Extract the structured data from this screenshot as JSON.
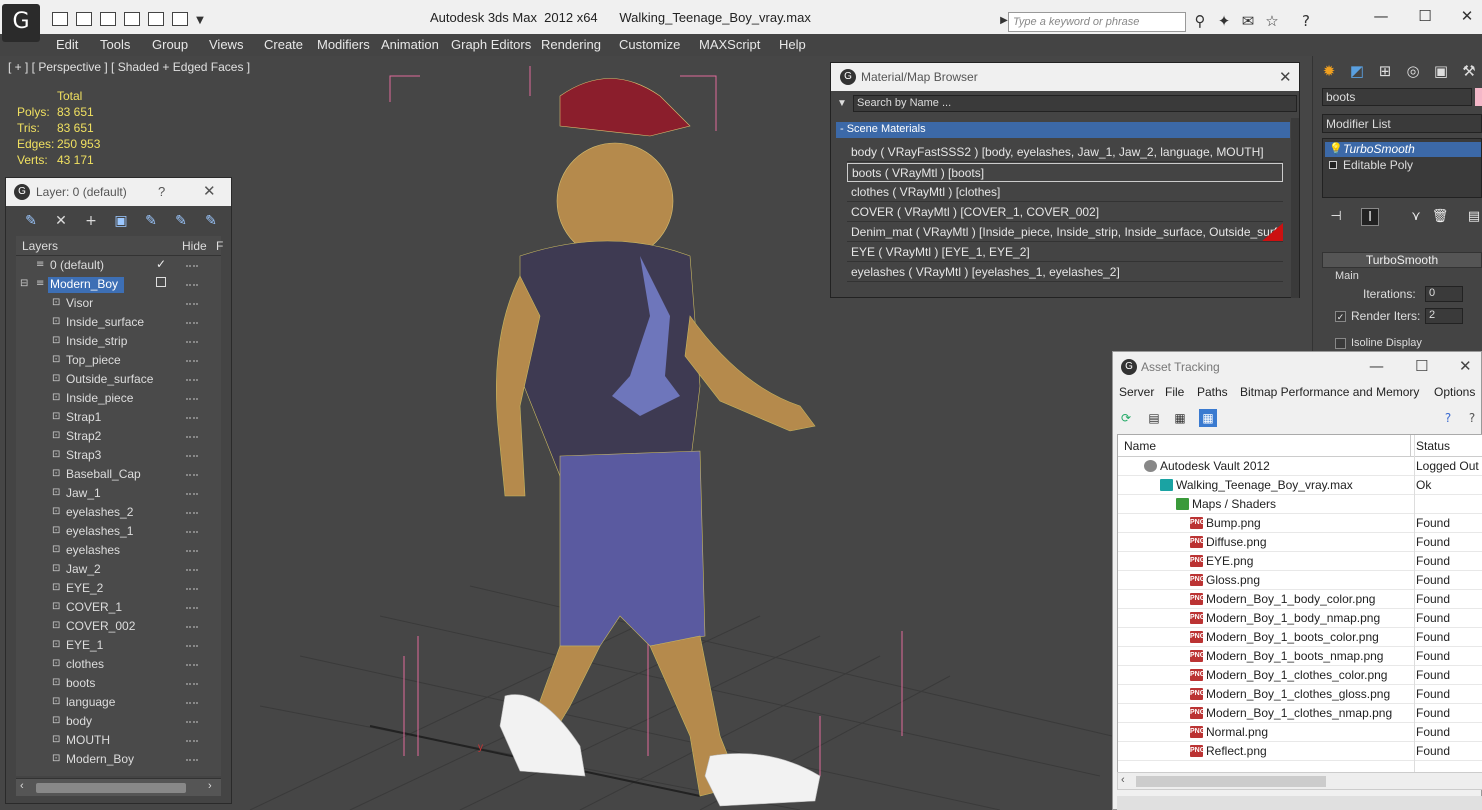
{
  "app": {
    "logo_glyph": "G",
    "title": "Autodesk 3ds Max  2012 x64      Walking_Teenage_Boy_vray.max",
    "search_placeholder": "Type a keyword or phrase"
  },
  "menu": [
    "Edit",
    "Tools",
    "Group",
    "Views",
    "Create",
    "Modifiers",
    "Animation",
    "Graph Editors",
    "Rendering",
    "Customize",
    "MAXScript",
    "Help"
  ],
  "viewport": {
    "label": "[ + ] [ Perspective ] [ Shaded + Edged Faces ]",
    "stats_header": "Total",
    "stats": [
      {
        "key": "Polys:",
        "value": "83 651"
      },
      {
        "key": "Tris:",
        "value": "83 651"
      },
      {
        "key": "Edges:",
        "value": "250 953"
      },
      {
        "key": "Verts:",
        "value": "43 171"
      }
    ],
    "axis_label": "y"
  },
  "layer_panel": {
    "title": "Layer: 0 (default)",
    "help": "?",
    "col_layers": "Layers",
    "col_hide": "Hide",
    "col_f": "F",
    "default_layer": "0 (default)",
    "selected_layer": "Modern_Boy",
    "objects": [
      "Visor",
      "Inside_surface",
      "Inside_strip",
      "Top_piece",
      "Outside_surface",
      "Inside_piece",
      "Strap1",
      "Strap2",
      "Strap3",
      "Baseball_Cap",
      "Jaw_1",
      "eyelashes_2",
      "eyelashes_1",
      "eyelashes",
      "Jaw_2",
      "EYE_2",
      "COVER_1",
      "COVER_002",
      "EYE_1",
      "clothes",
      "boots",
      "language",
      "body",
      "MOUTH",
      "Modern_Boy"
    ]
  },
  "material_browser": {
    "title": "Material/Map Browser",
    "search_placeholder": "Search by Name ...",
    "group_title": "- Scene Materials",
    "materials": [
      "body  ( VRayFastSSS2 ) [body, eyelashes, Jaw_1, Jaw_2, language, MOUTH]",
      "boots  ( VRayMtl ) [boots]",
      "clothes  ( VRayMtl ) [clothes]",
      "COVER  ( VRayMtl ) [COVER_1, COVER_002]",
      "Denim_mat  ( VRayMtl ) [Inside_piece, Inside_strip, Inside_surface, Outside_surfa...",
      "EYE  ( VRayMtl ) [EYE_1, EYE_2]",
      "eyelashes  ( VRayMtl ) [eyelashes_1, eyelashes_2]"
    ],
    "selected_index": 1
  },
  "command_panel": {
    "object_name": "boots",
    "object_color": "#f4b7c8",
    "modifier_list": "Modifier List",
    "stack": [
      "TurboSmooth",
      "Editable Poly"
    ],
    "rollout_title": "TurboSmooth",
    "main_label": "Main",
    "iterations_label": "Iterations:",
    "iterations_value": "0",
    "render_iters_label": "Render Iters:",
    "render_iters_value": "2",
    "render_iters_checked": true,
    "isoline_label": "Isoline Display"
  },
  "asset_tracking": {
    "title": "Asset Tracking",
    "menu": [
      "Server",
      "File",
      "Paths",
      "Bitmap Performance and Memory",
      "Options"
    ],
    "col_name": "Name",
    "col_status": "Status",
    "rows": [
      {
        "name": "Autodesk Vault 2012",
        "status": "Logged Out",
        "level": 0,
        "icon": "vault"
      },
      {
        "name": "Walking_Teenage_Boy_vray.max",
        "status": "Ok",
        "level": 1,
        "icon": "max"
      },
      {
        "name": "Maps / Shaders",
        "status": "",
        "level": 2,
        "icon": "folder"
      },
      {
        "name": "Bump.png",
        "status": "Found",
        "level": 3,
        "icon": "png"
      },
      {
        "name": "Diffuse.png",
        "status": "Found",
        "level": 3,
        "icon": "png"
      },
      {
        "name": "EYE.png",
        "status": "Found",
        "level": 3,
        "icon": "png"
      },
      {
        "name": "Gloss.png",
        "status": "Found",
        "level": 3,
        "icon": "png"
      },
      {
        "name": "Modern_Boy_1_body_color.png",
        "status": "Found",
        "level": 3,
        "icon": "png"
      },
      {
        "name": "Modern_Boy_1_body_nmap.png",
        "status": "Found",
        "level": 3,
        "icon": "png"
      },
      {
        "name": "Modern_Boy_1_boots_color.png",
        "status": "Found",
        "level": 3,
        "icon": "png"
      },
      {
        "name": "Modern_Boy_1_boots_nmap.png",
        "status": "Found",
        "level": 3,
        "icon": "png"
      },
      {
        "name": "Modern_Boy_1_clothes_color.png",
        "status": "Found",
        "level": 3,
        "icon": "png"
      },
      {
        "name": "Modern_Boy_1_clothes_gloss.png",
        "status": "Found",
        "level": 3,
        "icon": "png"
      },
      {
        "name": "Modern_Boy_1_clothes_nmap.png",
        "status": "Found",
        "level": 3,
        "icon": "png"
      },
      {
        "name": "Normal.png",
        "status": "Found",
        "level": 3,
        "icon": "png"
      },
      {
        "name": "Reflect.png",
        "status": "Found",
        "level": 3,
        "icon": "png"
      }
    ],
    "png_icon_text": "PNG"
  }
}
